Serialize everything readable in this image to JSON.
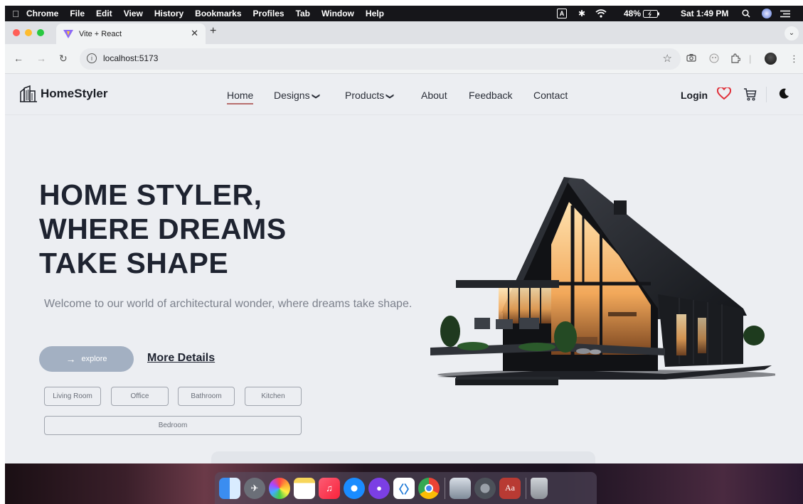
{
  "menubar": {
    "app_name": "Chrome",
    "items": [
      "File",
      "Edit",
      "View",
      "History",
      "Bookmarks",
      "Profiles",
      "Tab",
      "Window",
      "Help"
    ],
    "input_source": "A",
    "battery": "48%",
    "clock": "Sat 1:49 PM"
  },
  "browser": {
    "tab_title": "Vite + React",
    "url": "localhost:5173"
  },
  "site": {
    "brand": "HomeStyler",
    "nav": [
      {
        "label": "Home"
      },
      {
        "label": "Designs"
      },
      {
        "label": "Products"
      },
      {
        "label": "About"
      },
      {
        "label": "Feedback"
      },
      {
        "label": "Contact"
      }
    ],
    "login_label": "Login",
    "accent_heart": "#e0303a"
  },
  "hero": {
    "title_lines": [
      "HOME STYLER,",
      "WHERE DREAMS",
      "TAKE SHAPE"
    ],
    "subtitle": "Welcome to our world of architectural wonder, where dreams take shape.",
    "explore_label": "explore",
    "more_label": "More Details",
    "chips": [
      "Living Room",
      "Office",
      "Bathroom",
      "Kitchen",
      "Bedroom"
    ]
  },
  "dock": {
    "apps": [
      "finder-icon",
      "launchpad-icon",
      "photos-icon",
      "notes-icon",
      "music-icon",
      "safari-icon",
      "github-desktop-icon",
      "vscode-icon",
      "chrome-icon",
      "preview-icon",
      "system-settings-icon",
      "dictionary-icon",
      "trash-icon"
    ],
    "dictionary_glyph": "Aa"
  }
}
